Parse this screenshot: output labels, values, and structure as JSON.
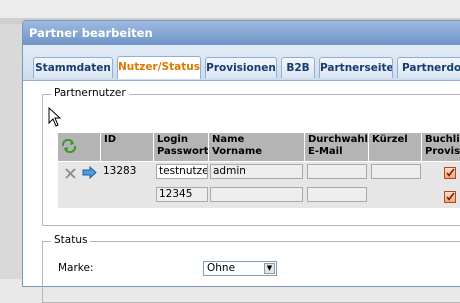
{
  "window": {
    "title": "Partner bearbeiten"
  },
  "tabs": [
    {
      "label": "Stammdaten",
      "active": false
    },
    {
      "label": "Nutzer/Status",
      "active": true
    },
    {
      "label": "Provisionen",
      "active": false
    },
    {
      "label": "B2B",
      "active": false
    },
    {
      "label": "Partnerseite",
      "active": false
    },
    {
      "label": "Partnerdok",
      "active": false
    }
  ],
  "partnernutzer": {
    "legend": "Partnernutzer",
    "columns": {
      "id": "ID",
      "login": "Login",
      "passwort": "Passwort",
      "name": "Name",
      "vorname": "Vorname",
      "durchwahl": "Durchwahl/",
      "email": "E-Mail",
      "kuerzel": "Kürzel",
      "buchli": "Buchli",
      "provis": "Provis"
    },
    "rows": [
      {
        "id": "13283",
        "login": "testnutzer",
        "passwort": "12345",
        "name": "admin",
        "vorname": "",
        "durchwahl": "",
        "email": "",
        "kuerzel": ""
      }
    ],
    "icons": {
      "refresh": "refresh-icon",
      "delete": "delete-x-icon",
      "arrow": "arrow-right-icon",
      "edit": "edit-checkbox-icon"
    }
  },
  "status": {
    "legend": "Status",
    "marke_label": "Marke:",
    "marke_value": "Ohne"
  },
  "colors": {
    "titlebar": "#6f94c7",
    "tab_active_text": "#e07800",
    "tab_text": "#163d70"
  }
}
